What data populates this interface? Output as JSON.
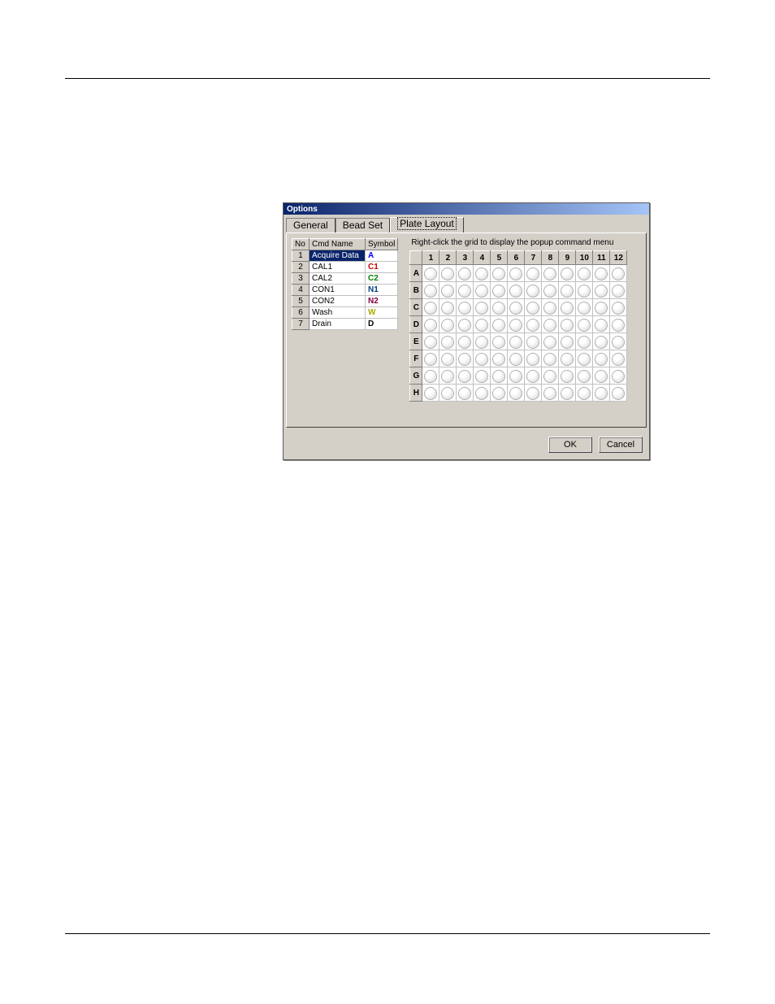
{
  "dialog": {
    "title": "Options",
    "tabs": [
      "General",
      "Bead Set",
      "Plate Layout"
    ],
    "active_tab_index": 2
  },
  "cmd_table": {
    "headers": [
      "No",
      "Cmd Name",
      "Symbol"
    ],
    "rows": [
      {
        "no": "1",
        "name": "Acquire Data",
        "symbol": "A",
        "symbol_color": "#0000ff",
        "selected": true
      },
      {
        "no": "2",
        "name": "CAL1",
        "symbol": "C1",
        "symbol_color": "#cc0000",
        "selected": false
      },
      {
        "no": "3",
        "name": "CAL2",
        "symbol": "C2",
        "symbol_color": "#008000",
        "selected": false
      },
      {
        "no": "4",
        "name": "CON1",
        "symbol": "N1",
        "symbol_color": "#004080",
        "selected": false
      },
      {
        "no": "5",
        "name": "CON2",
        "symbol": "N2",
        "symbol_color": "#800040",
        "selected": false
      },
      {
        "no": "6",
        "name": "Wash",
        "symbol": "W",
        "symbol_color": "#aaaa00",
        "selected": false
      },
      {
        "no": "7",
        "name": "Drain",
        "symbol": "D",
        "symbol_color": "#000000",
        "selected": false
      }
    ]
  },
  "plate": {
    "hint": "Right-click the grid to display the popup command menu",
    "columns": [
      "1",
      "2",
      "3",
      "4",
      "5",
      "6",
      "7",
      "8",
      "9",
      "10",
      "11",
      "12"
    ],
    "rows": [
      "A",
      "B",
      "C",
      "D",
      "E",
      "F",
      "G",
      "H"
    ]
  },
  "buttons": {
    "ok": "OK",
    "cancel": "Cancel"
  }
}
